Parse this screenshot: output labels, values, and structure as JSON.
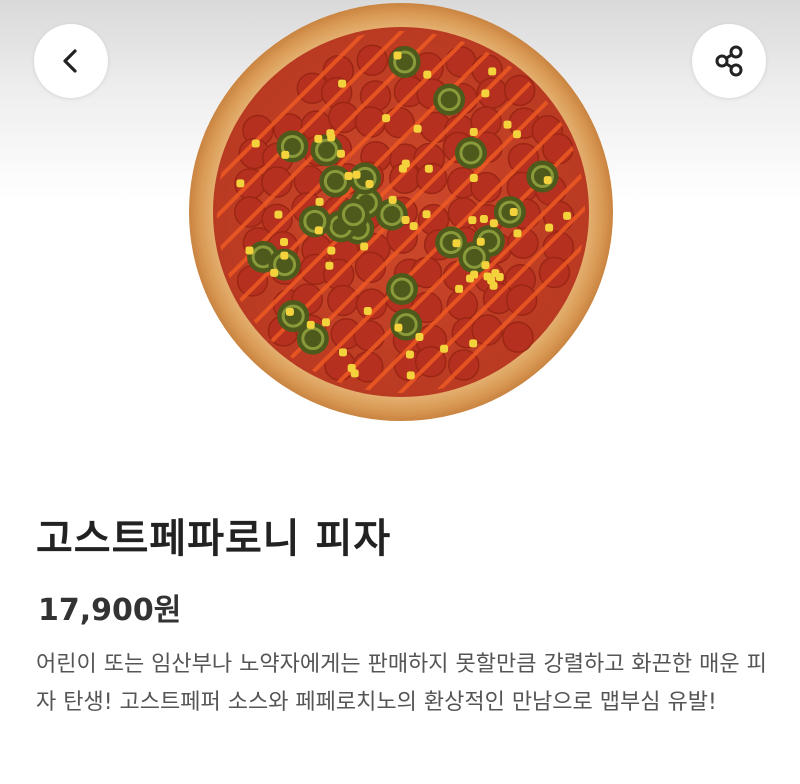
{
  "header": {
    "back_icon": "chevron-left-icon",
    "share_icon": "share-icon"
  },
  "product": {
    "image": "pizza-image",
    "name": "고스트페파로니 피자",
    "price": "17,900원",
    "description": "어린이 또는 임산부나 노약자에게는 판매하지 못할만큼 강렬하고 화끈한 매운 피자 탄생! 고스트페퍼 소스와 페페로치노의 환상적인 만남으로 맵부심 유발!"
  },
  "colors": {
    "crust": "#e2a564",
    "sauce": "#c8402a",
    "pepperoni": "#b5301e",
    "jalapeno": "#4e5a1c",
    "corn": "#f3d23c",
    "drizzle": "#ef5a24"
  }
}
